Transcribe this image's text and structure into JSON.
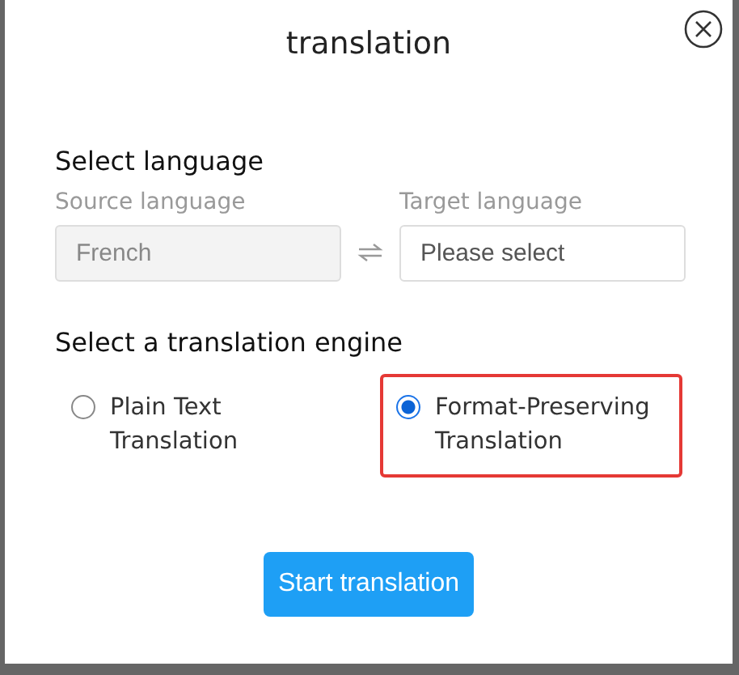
{
  "dialog": {
    "title": "translation"
  },
  "language": {
    "heading": "Select language",
    "source": {
      "label": "Source language",
      "value": "French",
      "disabled": true
    },
    "target": {
      "label": "Target language",
      "placeholder": "Please select",
      "disabled": false
    }
  },
  "engine": {
    "heading": "Select a translation engine",
    "options": [
      {
        "label": "Plain Text Translation",
        "selected": false
      },
      {
        "label": "Format-Preserving Translation",
        "selected": true
      }
    ]
  },
  "button": "Start translation"
}
